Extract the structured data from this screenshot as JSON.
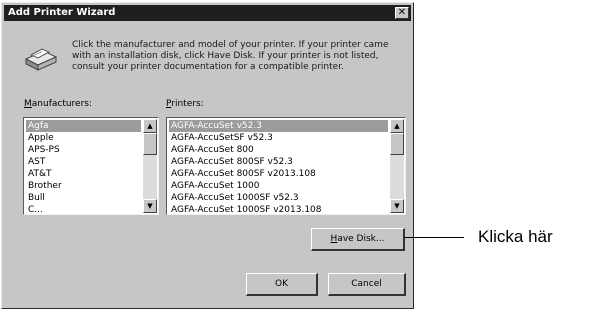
{
  "window": {
    "title": "Add Printer Wizard",
    "close_glyph": "✕"
  },
  "intro_text": "Click the manufacturer and model of your printer. If your printer came with an installation disk, click Have Disk. If your printer is not listed, consult your printer documentation for a compatible printer.",
  "manufacturers": {
    "label_accel": "M",
    "label_rest": "anufacturers:",
    "items": [
      "Agfa",
      "Apple",
      "APS-PS",
      "AST",
      "AT&T",
      "Brother",
      "Bull",
      "C..."
    ],
    "selected_index": 0
  },
  "printers": {
    "label_accel": "P",
    "label_rest": "rinters:",
    "items": [
      "AGFA-AccuSet v52.3",
      "AGFA-AccuSetSF v52.3",
      "AGFA-AccuSet 800",
      "AGFA-AccuSet 800SF v52.3",
      "AGFA-AccuSet 800SF v2013.108",
      "AGFA-AccuSet 1000",
      "AGFA-AccuSet 1000SF v52.3",
      "AGFA-AccuSet 1000SF v2013.108"
    ],
    "selected_index": 0
  },
  "buttons": {
    "have_disk_accel": "H",
    "have_disk_rest": "ave Disk...",
    "ok": "OK",
    "cancel": "Cancel"
  },
  "icons": {
    "printer": "printer-icon",
    "arrow_up": "▲",
    "arrow_down": "▼"
  },
  "callout": {
    "text": "Klicka här"
  }
}
